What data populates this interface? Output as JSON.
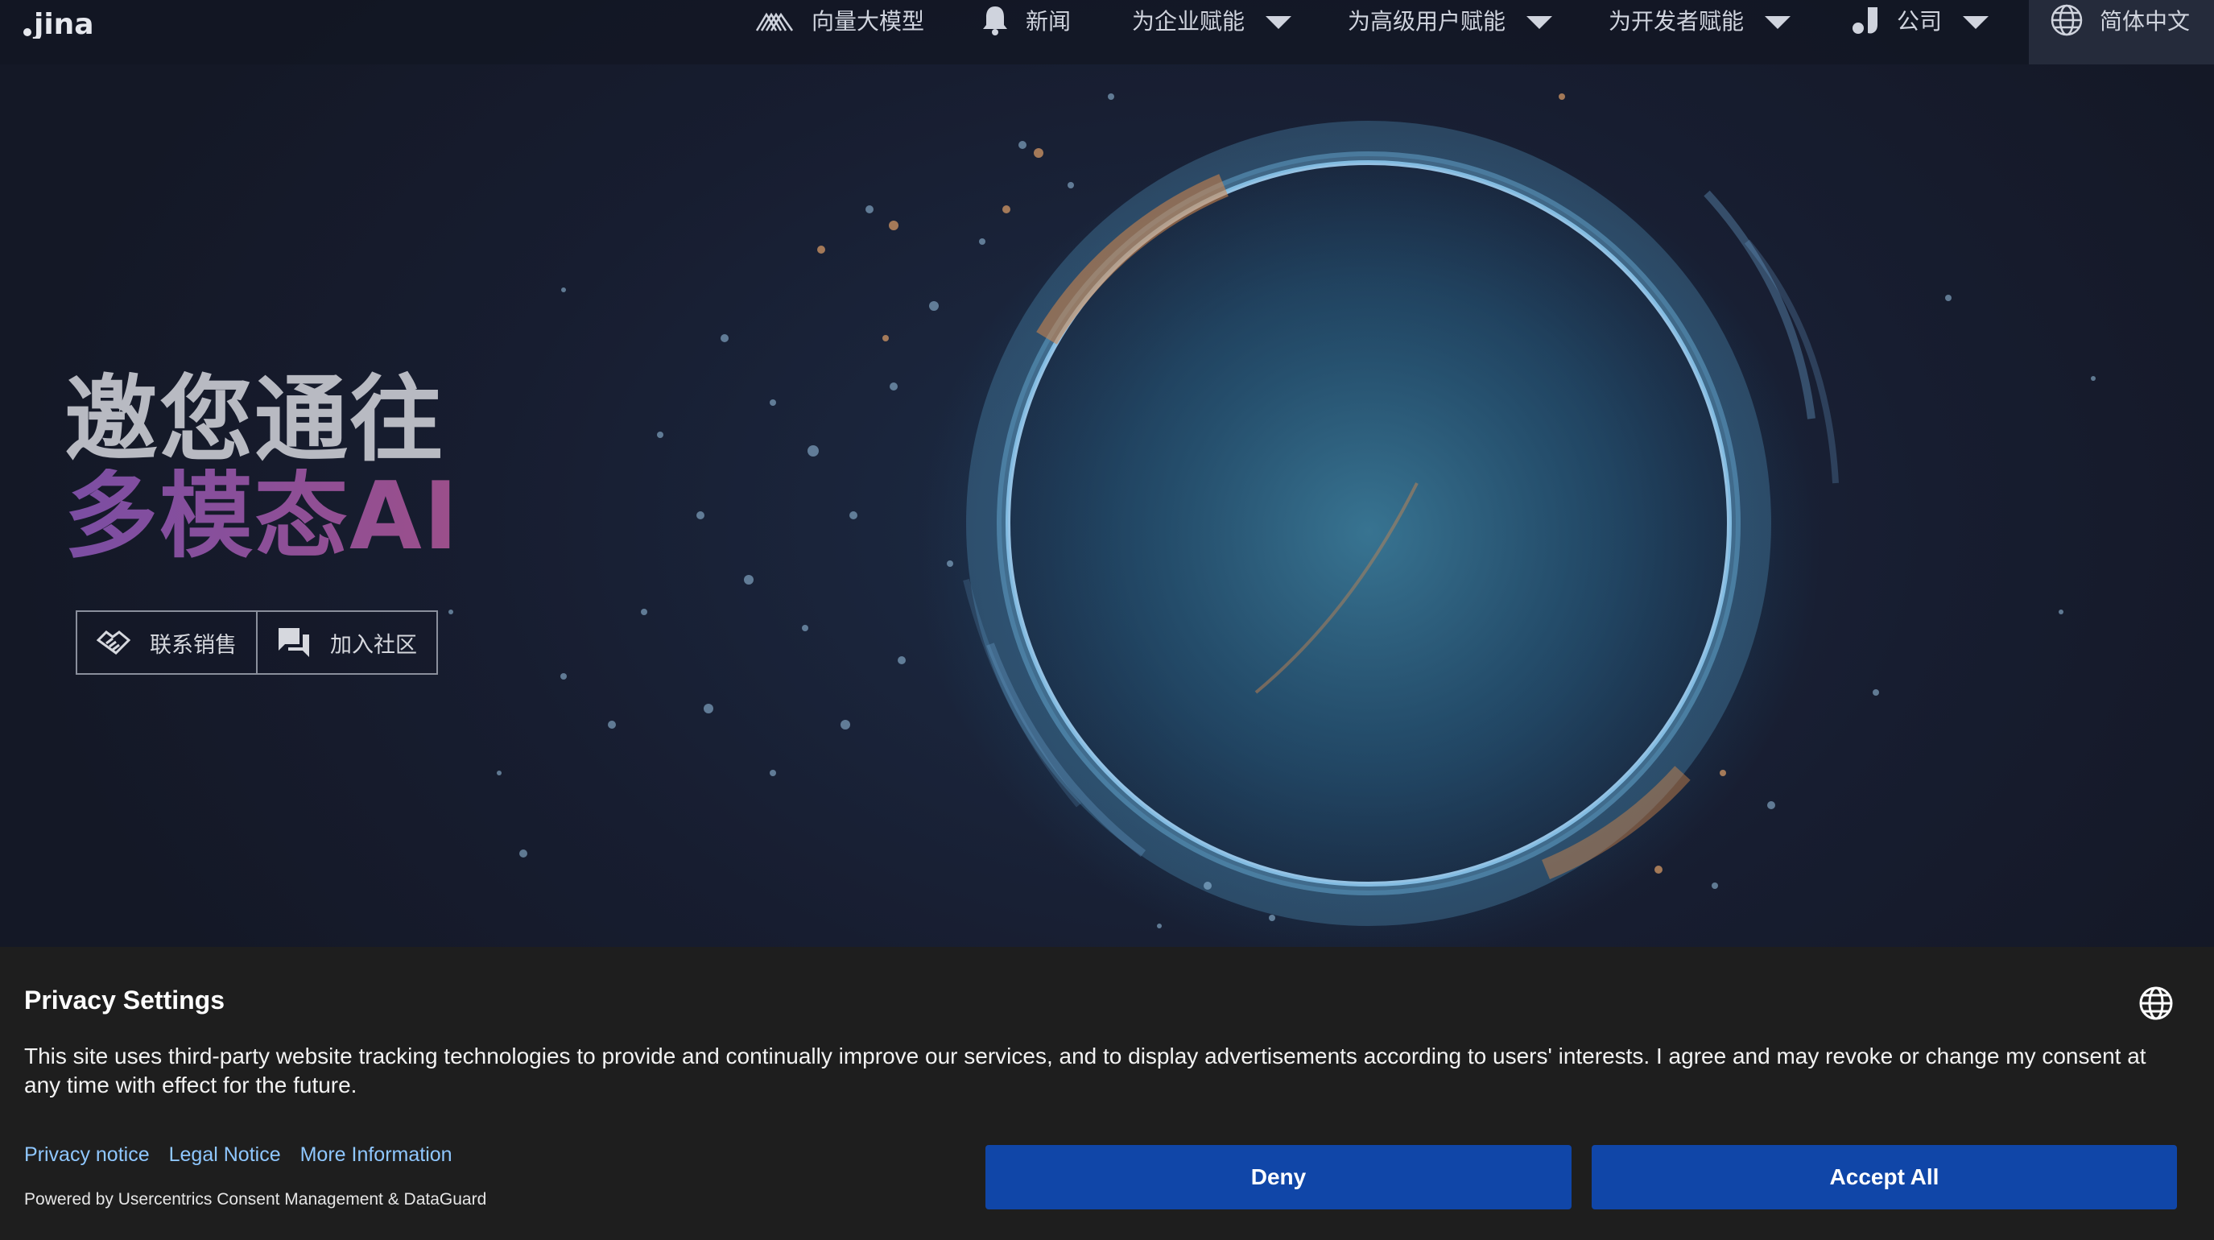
{
  "nav": {
    "logo_text": "jina",
    "items": [
      {
        "label": "向量大模型",
        "icon": "wave-stack-icon",
        "has_dropdown": false
      },
      {
        "label": "新闻",
        "icon": "bell-icon",
        "has_dropdown": false
      },
      {
        "label": "为企业赋能",
        "icon": "",
        "has_dropdown": true
      },
      {
        "label": "为高级用户赋能",
        "icon": "",
        "has_dropdown": true
      },
      {
        "label": "为开发者赋能",
        "icon": "",
        "has_dropdown": true
      },
      {
        "label": "公司",
        "icon": "jina-mark-icon",
        "has_dropdown": true
      }
    ],
    "language": {
      "label": "简体中文",
      "icon": "globe-icon"
    }
  },
  "hero": {
    "headline_line1": "邀您通往",
    "headline_line2": "多模态AI",
    "buttons": [
      {
        "label": "联系销售",
        "icon": "handshake-icon"
      },
      {
        "label": "加入社区",
        "icon": "chat-bubbles-icon"
      }
    ]
  },
  "consent": {
    "title": "Privacy Settings",
    "body": "This site uses third-party website tracking technologies to provide and continually improve our services, and to display advertisements according to users' interests. I agree and may revoke or change my consent at any time with effect for the future.",
    "links": [
      "Privacy notice",
      "Legal Notice",
      "More Information"
    ],
    "powered_by": "Powered by Usercentrics Consent Management & DataGuard",
    "deny_label": "Deny",
    "accept_label": "Accept All",
    "button_color": "#1046a8",
    "link_color": "#8fc7ff"
  }
}
